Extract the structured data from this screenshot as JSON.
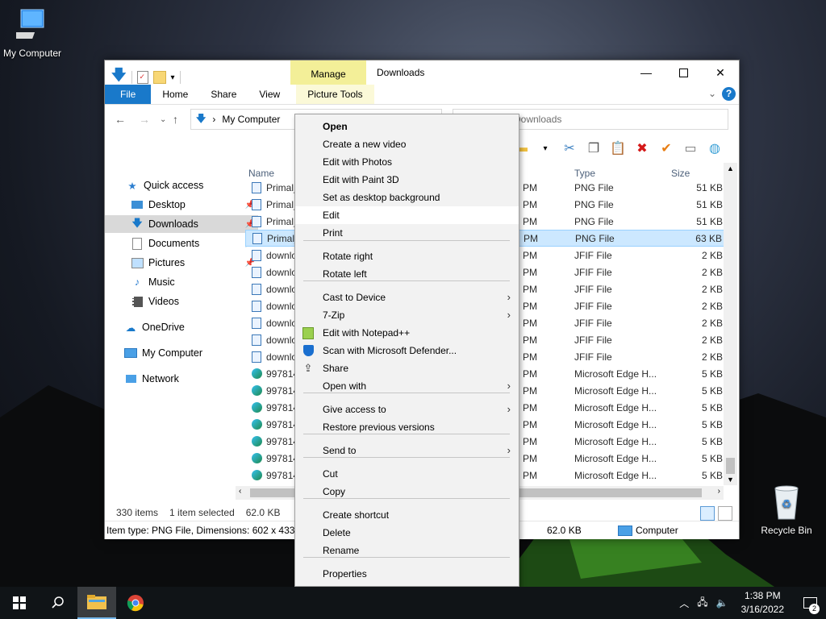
{
  "desktop": {
    "icons": [
      {
        "label": "My Computer"
      },
      {
        "label": "Recycle Bin"
      }
    ]
  },
  "window": {
    "title": "Downloads",
    "manage_label": "Manage",
    "ribbon_tabs": [
      "File",
      "Home",
      "Share",
      "View",
      "Picture Tools"
    ],
    "address": "My Computer",
    "search_placeholder": "Downloads",
    "columns": {
      "name": "Name",
      "type": "Type",
      "size": "Size"
    },
    "nav": [
      {
        "label": "Quick access"
      },
      {
        "label": "Desktop"
      },
      {
        "label": "Downloads"
      },
      {
        "label": "Documents"
      },
      {
        "label": "Pictures"
      },
      {
        "label": "Music"
      },
      {
        "label": "Videos"
      },
      {
        "label": "OneDrive"
      },
      {
        "label": "My Computer"
      },
      {
        "label": "Network"
      }
    ],
    "rows": [
      {
        "name": "Primal_",
        "pm": "PM",
        "type": "PNG File",
        "size": "51 KB",
        "icon": "image"
      },
      {
        "name": "Primal_",
        "pm": "PM",
        "type": "PNG File",
        "size": "51 KB",
        "icon": "image"
      },
      {
        "name": "Primal_",
        "pm": "PM",
        "type": "PNG File",
        "size": "51 KB",
        "icon": "image"
      },
      {
        "name": "Primal_",
        "pm": "PM",
        "type": "PNG File",
        "size": "63 KB",
        "icon": "image"
      },
      {
        "name": "downlo",
        "pm": "PM",
        "type": "JFIF File",
        "size": "2 KB",
        "icon": "image"
      },
      {
        "name": "downlo",
        "pm": "PM",
        "type": "JFIF File",
        "size": "2 KB",
        "icon": "image"
      },
      {
        "name": "downlo",
        "pm": "PM",
        "type": "JFIF File",
        "size": "2 KB",
        "icon": "image"
      },
      {
        "name": "downlo",
        "pm": "PM",
        "type": "JFIF File",
        "size": "2 KB",
        "icon": "image"
      },
      {
        "name": "downlo",
        "pm": "PM",
        "type": "JFIF File",
        "size": "2 KB",
        "icon": "image"
      },
      {
        "name": "downlo",
        "pm": "PM",
        "type": "JFIF File",
        "size": "2 KB",
        "icon": "image"
      },
      {
        "name": "downlo",
        "pm": "PM",
        "type": "JFIF File",
        "size": "2 KB",
        "icon": "image"
      },
      {
        "name": "997814",
        "pm": "PM",
        "type": "Microsoft Edge H...",
        "size": "5 KB",
        "icon": "edge"
      },
      {
        "name": "997814",
        "pm": "PM",
        "type": "Microsoft Edge H...",
        "size": "5 KB",
        "icon": "edge"
      },
      {
        "name": "997814",
        "pm": "PM",
        "type": "Microsoft Edge H...",
        "size": "5 KB",
        "icon": "edge"
      },
      {
        "name": "997814",
        "pm": "PM",
        "type": "Microsoft Edge H...",
        "size": "5 KB",
        "icon": "edge"
      },
      {
        "name": "997814",
        "pm": "PM",
        "type": "Microsoft Edge H...",
        "size": "5 KB",
        "icon": "edge"
      },
      {
        "name": "997814",
        "pm": "PM",
        "type": "Microsoft Edge H...",
        "size": "5 KB",
        "icon": "edge"
      },
      {
        "name": "997814",
        "pm": "PM",
        "type": "Microsoft Edge H...",
        "size": "5 KB",
        "icon": "edge"
      }
    ],
    "status": {
      "count": "330 items",
      "selected": "1 item selected",
      "size": "62.0 KB"
    },
    "details": {
      "text": "Item type: PNG File, Dimensions: 602 x 433, S",
      "size": "62.0 KB",
      "location": "Computer"
    }
  },
  "context_menu": {
    "items": [
      {
        "label": "Open",
        "bold": true
      },
      {
        "label": "Create a new video"
      },
      {
        "label": "Edit with Photos"
      },
      {
        "label": "Edit with Paint 3D"
      },
      {
        "label": "Set as desktop background"
      },
      {
        "label": "Edit"
      },
      {
        "label": "Print"
      },
      {
        "label": "Rotate right"
      },
      {
        "label": "Rotate left"
      },
      {
        "label": "Cast to Device",
        "submenu": true
      },
      {
        "label": "7-Zip",
        "submenu": true
      },
      {
        "label": "Edit with Notepad++",
        "icon": "notepad-icon"
      },
      {
        "label": "Scan with Microsoft Defender...",
        "icon": "defender-icon"
      },
      {
        "label": "Share",
        "icon": "share-icon"
      },
      {
        "label": "Open with",
        "submenu": true
      },
      {
        "label": "Give access to",
        "submenu": true
      },
      {
        "label": "Restore previous versions"
      },
      {
        "label": "Send to",
        "submenu": true
      },
      {
        "label": "Cut"
      },
      {
        "label": "Copy"
      },
      {
        "label": "Create shortcut"
      },
      {
        "label": "Delete"
      },
      {
        "label": "Rename"
      },
      {
        "label": "Properties"
      }
    ]
  },
  "taskbar": {
    "time": "1:38 PM",
    "date": "3/16/2022",
    "notification_count": "2"
  },
  "colors": {
    "accent": "#1979ca",
    "selection": "#cce8ff",
    "manage": "#f3ef98"
  }
}
